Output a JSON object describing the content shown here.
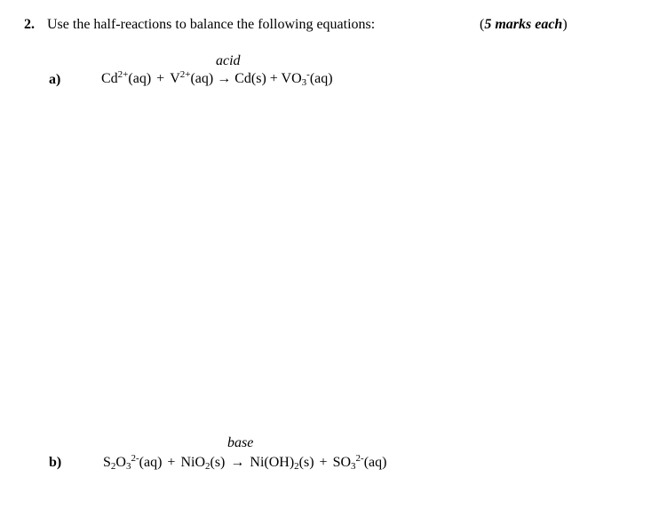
{
  "question": {
    "number": "2.",
    "text": "Use the half-reactions to balance the following equations:",
    "marks_open": "(",
    "marks_text": "5 marks each",
    "marks_close": ")"
  },
  "parts": [
    {
      "label": "a)",
      "condition": "acid",
      "equation": {
        "r1_base": "Cd",
        "r1_charge": "2+",
        "r1_state": "(aq)",
        "plus1": "+",
        "r2_base": "V",
        "r2_charge": "2+",
        "r2_state": "(aq)",
        "arrow": "→",
        "p1": "Cd(s)",
        "plus2": "+",
        "p2_base": "VO",
        "p2_sub": "3",
        "p2_charge": "-",
        "p2_state": "(aq)"
      }
    },
    {
      "label": "b)",
      "condition": "base",
      "equation": {
        "r1_a": "S",
        "r1_sub1": "2",
        "r1_b": "O",
        "r1_sub2": "3",
        "r1_charge": "2-",
        "r1_state": "(aq)",
        "plus1": "+",
        "r2_base": "NiO",
        "r2_sub": "2",
        "r2_state": "(s)",
        "arrow": "→",
        "p1_base": "Ni(OH)",
        "p1_sub": "2",
        "p1_state": "(s)",
        "plus2": "+",
        "p2_base": "SO",
        "p2_sub": "3",
        "p2_charge": "2-",
        "p2_state": "(aq)"
      }
    }
  ]
}
